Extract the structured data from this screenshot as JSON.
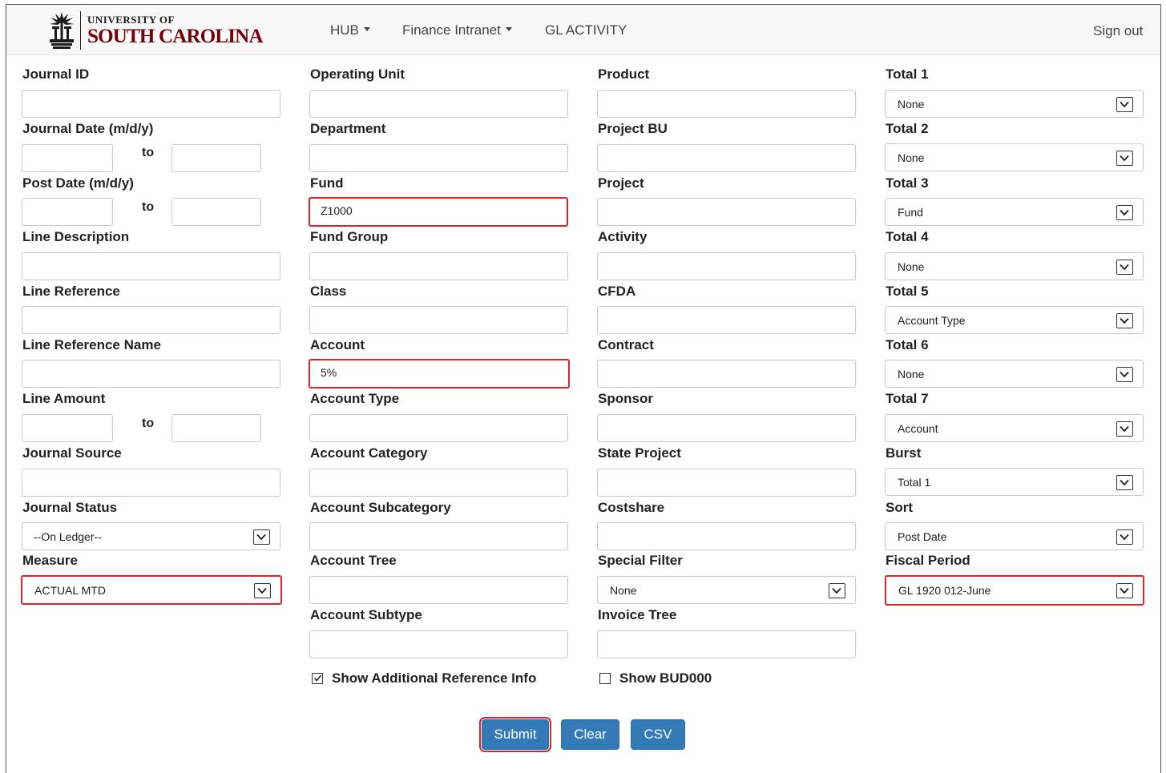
{
  "header": {
    "logo_top": "UNIVERSITY OF",
    "logo_bottom": "SOUTH CAROLINA",
    "nav": [
      {
        "label": "HUB",
        "dropdown": true
      },
      {
        "label": "Finance Intranet",
        "dropdown": true
      },
      {
        "label": "GL ACTIVITY",
        "dropdown": false
      }
    ],
    "sign_out": "Sign out"
  },
  "colors": {
    "highlight": "#d9262e",
    "button": "#337ab7",
    "brand_garnet": "#73000a"
  },
  "column1": {
    "journal_id": {
      "label": "Journal ID",
      "value": ""
    },
    "journal_date": {
      "label": "Journal Date (m/d/y)",
      "from": "",
      "to_label": "to",
      "to": ""
    },
    "post_date": {
      "label": "Post Date (m/d/y)",
      "from": "",
      "to_label": "to",
      "to": ""
    },
    "line_description": {
      "label": "Line Description",
      "value": ""
    },
    "line_reference": {
      "label": "Line Reference",
      "value": ""
    },
    "line_reference_name": {
      "label": "Line Reference Name",
      "value": ""
    },
    "line_amount": {
      "label": "Line Amount",
      "from": "",
      "to_label": "to",
      "to": ""
    },
    "journal_source": {
      "label": "Journal Source",
      "value": ""
    },
    "journal_status": {
      "label": "Journal Status",
      "value": "--On Ledger--"
    },
    "measure": {
      "label": "Measure",
      "value": "ACTUAL MTD",
      "highlighted": true
    }
  },
  "column2": {
    "operating_unit": {
      "label": "Operating Unit",
      "value": ""
    },
    "department": {
      "label": "Department",
      "value": ""
    },
    "fund": {
      "label": "Fund",
      "value": "Z1000",
      "highlighted": true
    },
    "fund_group": {
      "label": "Fund Group",
      "value": ""
    },
    "class": {
      "label": "Class",
      "value": ""
    },
    "account": {
      "label": "Account",
      "value": "5%",
      "highlighted": true
    },
    "account_type": {
      "label": "Account Type",
      "value": ""
    },
    "account_category": {
      "label": "Account Category",
      "value": ""
    },
    "account_subcategory": {
      "label": "Account Subcategory",
      "value": ""
    },
    "account_tree": {
      "label": "Account Tree",
      "value": ""
    },
    "account_subtype": {
      "label": "Account Subtype",
      "value": ""
    },
    "show_additional": {
      "label": "Show Additional Reference Info",
      "checked": true
    }
  },
  "column3": {
    "product": {
      "label": "Product",
      "value": ""
    },
    "project_bu": {
      "label": "Project BU",
      "value": ""
    },
    "project": {
      "label": "Project",
      "value": ""
    },
    "activity": {
      "label": "Activity",
      "value": ""
    },
    "cfda": {
      "label": "CFDA",
      "value": ""
    },
    "contract": {
      "label": "Contract",
      "value": ""
    },
    "sponsor": {
      "label": "Sponsor",
      "value": ""
    },
    "state_project": {
      "label": "State Project",
      "value": ""
    },
    "costshare": {
      "label": "Costshare",
      "value": ""
    },
    "special_filter": {
      "label": "Special Filter",
      "value": "None"
    },
    "invoice_tree": {
      "label": "Invoice Tree",
      "value": ""
    },
    "show_bud000": {
      "label": "Show BUD000",
      "checked": false
    }
  },
  "column4": {
    "total1": {
      "label": "Total 1",
      "value": "None"
    },
    "total2": {
      "label": "Total 2",
      "value": "None"
    },
    "total3": {
      "label": "Total 3",
      "value": "Fund"
    },
    "total4": {
      "label": "Total 4",
      "value": "None"
    },
    "total5": {
      "label": "Total 5",
      "value": "Account Type"
    },
    "total6": {
      "label": "Total 6",
      "value": "None"
    },
    "total7": {
      "label": "Total 7",
      "value": "Account"
    },
    "burst": {
      "label": "Burst",
      "value": "Total 1"
    },
    "sort": {
      "label": "Sort",
      "value": "Post Date"
    },
    "fiscal_period": {
      "label": "Fiscal Period",
      "value": "GL 1920 012-June",
      "highlighted": true
    }
  },
  "actions": {
    "submit": "Submit",
    "clear": "Clear",
    "csv": "CSV"
  }
}
